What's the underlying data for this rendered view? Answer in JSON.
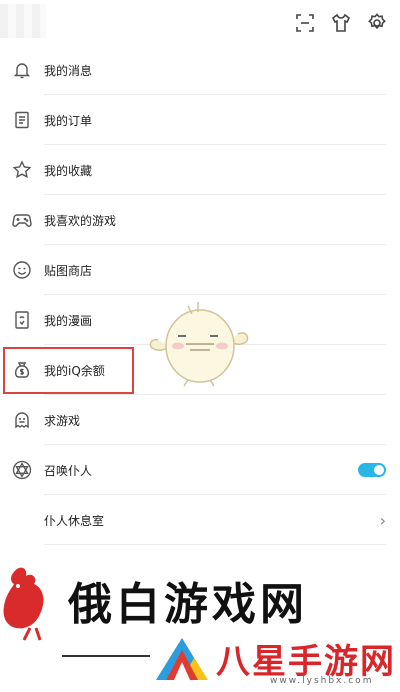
{
  "menu": {
    "items": [
      {
        "label": "我的消息",
        "icon": "bell-icon"
      },
      {
        "label": "我的订单",
        "icon": "order-icon"
      },
      {
        "label": "我的收藏",
        "icon": "star-icon"
      },
      {
        "label": "我喜欢的游戏",
        "icon": "gamepad-icon"
      },
      {
        "label": "贴图商店",
        "icon": "emoji-icon"
      },
      {
        "label": "我的漫画",
        "icon": "comic-icon"
      },
      {
        "label": "我的iQ余额",
        "icon": "money-bag-icon"
      },
      {
        "label": "求游戏",
        "icon": "ghost-icon"
      },
      {
        "label": "召唤仆人",
        "icon": "hexagram-icon"
      },
      {
        "label": "仆人休息室",
        "icon": ""
      }
    ],
    "summon_toggle_on": true
  },
  "watermark": {
    "title": "俄白游戏网",
    "site": "八星手游网",
    "url": "www.lyshbx.com"
  },
  "colors": {
    "highlight": "#d9453a",
    "toggle": "#2ab7e8",
    "watermark_site": "#d9262b"
  }
}
